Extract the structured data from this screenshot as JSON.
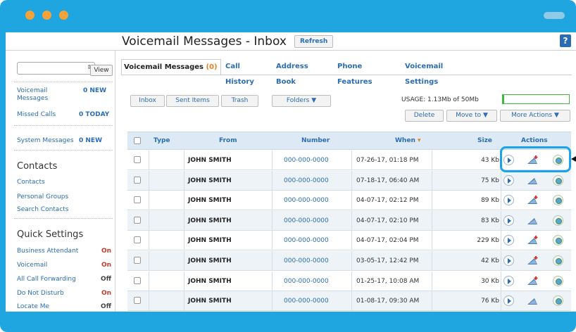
{
  "page": {
    "title": "Voicemail Messages - Inbox",
    "refresh_label": "Refresh",
    "help_label": "?"
  },
  "colors": {
    "accent": "#1fa6e0",
    "link": "#2a6db5",
    "on": "#c0392b",
    "orange": "#e67e22"
  },
  "sidebar": {
    "view_label": "View",
    "voicemail_label": "Voicemail Messages",
    "voicemail_count": "0 NEW",
    "missed_label": "Missed Calls",
    "missed_count": "0 TODAY",
    "system_label": "System Messages",
    "system_count": "0 NEW",
    "contacts_heading": "Contacts",
    "contacts_links": [
      "Contacts",
      "Personal Groups",
      "Search Contacts"
    ],
    "quick_heading": "Quick Settings",
    "quick_settings": [
      {
        "label": "Business Attendant",
        "state": "On"
      },
      {
        "label": "Voicemail",
        "state": "On"
      },
      {
        "label": "All Call Forwarding",
        "state": "Off"
      },
      {
        "label": "Do Not Disturb",
        "state": "On"
      },
      {
        "label": "Locate Me",
        "state": "Off"
      }
    ]
  },
  "tabs": [
    {
      "label": "Voicemail Messages",
      "count": "(0)"
    },
    {
      "label": "Call History"
    },
    {
      "label": "Address Book"
    },
    {
      "label": "Phone Features"
    },
    {
      "label": "Voicemail Settings"
    }
  ],
  "toolbar": {
    "inbox": "Inbox",
    "sent": "Sent Items",
    "trash": "Trash",
    "folders": "Folders ▼",
    "usage": "USAGE: 1.13Mb of 50Mb",
    "usage_fraction": 0.0226,
    "delete": "Delete",
    "move_to": "Move to ▼",
    "more_actions": "More Actions ▼"
  },
  "table": {
    "headers": {
      "type": "Type",
      "from": "From",
      "number": "Number",
      "when": "When",
      "when_sort": "▾",
      "size": "Size",
      "actions": "Actions"
    },
    "rows": [
      {
        "from": "JOHN SMITH",
        "number": "000-000-0000",
        "when": "07-26-17, 01:18 PM",
        "size": "43 Kb"
      },
      {
        "from": "JOHN SMITH",
        "number": "000-000-0000",
        "when": "07-18-17, 06:40 AM",
        "size": "75 Kb"
      },
      {
        "from": "JOHN SMITH",
        "number": "000-000-0000",
        "when": "04-07-17, 02:12 PM",
        "size": "89 Kb"
      },
      {
        "from": "JOHN SMITH",
        "number": "000-000-0000",
        "when": "04-07-17, 02:10 PM",
        "size": "83 Kb"
      },
      {
        "from": "JOHN SMITH",
        "number": "000-000-0000",
        "when": "04-07-17, 02:04 PM",
        "size": "229 Kb"
      },
      {
        "from": "JOHN SMITH",
        "number": "000-000-0000",
        "when": "03-05-17, 12:42 PM",
        "size": "42 Kb"
      },
      {
        "from": "JOHN SMITH",
        "number": "000-000-0000",
        "when": "01-25-17, 10:08 AM",
        "size": "30 Kb"
      },
      {
        "from": "JOHN SMITH",
        "number": "000-000-0000",
        "when": "01-08-17, 09:30 AM",
        "size": "76 Kb"
      }
    ],
    "action_icons": [
      "play-icon",
      "forward-voicemail-icon",
      "save-to-computer-icon"
    ]
  }
}
